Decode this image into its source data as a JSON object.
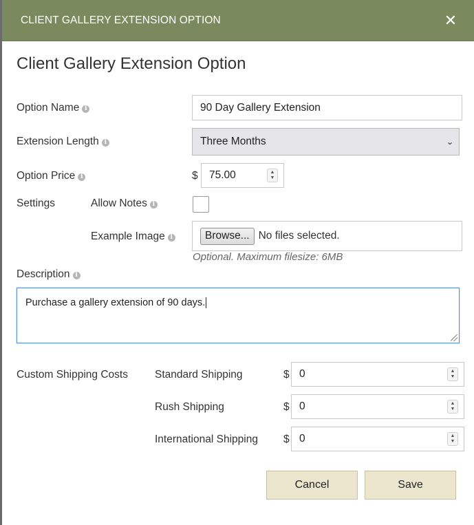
{
  "modal": {
    "header_title": "CLIENT GALLERY EXTENSION OPTION",
    "close_glyph": "✕",
    "title": "Client Gallery Extension Option",
    "info_glyph": "i"
  },
  "form": {
    "option_name": {
      "label": "Option Name",
      "value": "90 Day Gallery Extension"
    },
    "extension_length": {
      "label": "Extension Length",
      "value": "Three Months"
    },
    "option_price": {
      "label": "Option Price",
      "currency": "$",
      "value": "75.00"
    },
    "settings": {
      "label": "Settings",
      "allow_notes_label": "Allow Notes",
      "allow_notes_checked": false,
      "example_image_label": "Example Image",
      "browse_label": "Browse...",
      "file_status": "No files selected.",
      "file_hint": "Optional. Maximum filesize: 6MB"
    },
    "description": {
      "label": "Description",
      "value": "Purchase a gallery extension of 90 days."
    }
  },
  "shipping": {
    "label": "Custom Shipping Costs",
    "currency": "$",
    "rows": [
      {
        "label": "Standard Shipping",
        "value": "0"
      },
      {
        "label": "Rush Shipping",
        "value": "0"
      },
      {
        "label": "International Shipping",
        "value": "0"
      }
    ]
  },
  "actions": {
    "cancel_label": "Cancel",
    "save_label": "Save"
  },
  "colors": {
    "header": "#7a8a5e",
    "button": "#ede6cf",
    "focus_border": "#5b8fc7"
  }
}
